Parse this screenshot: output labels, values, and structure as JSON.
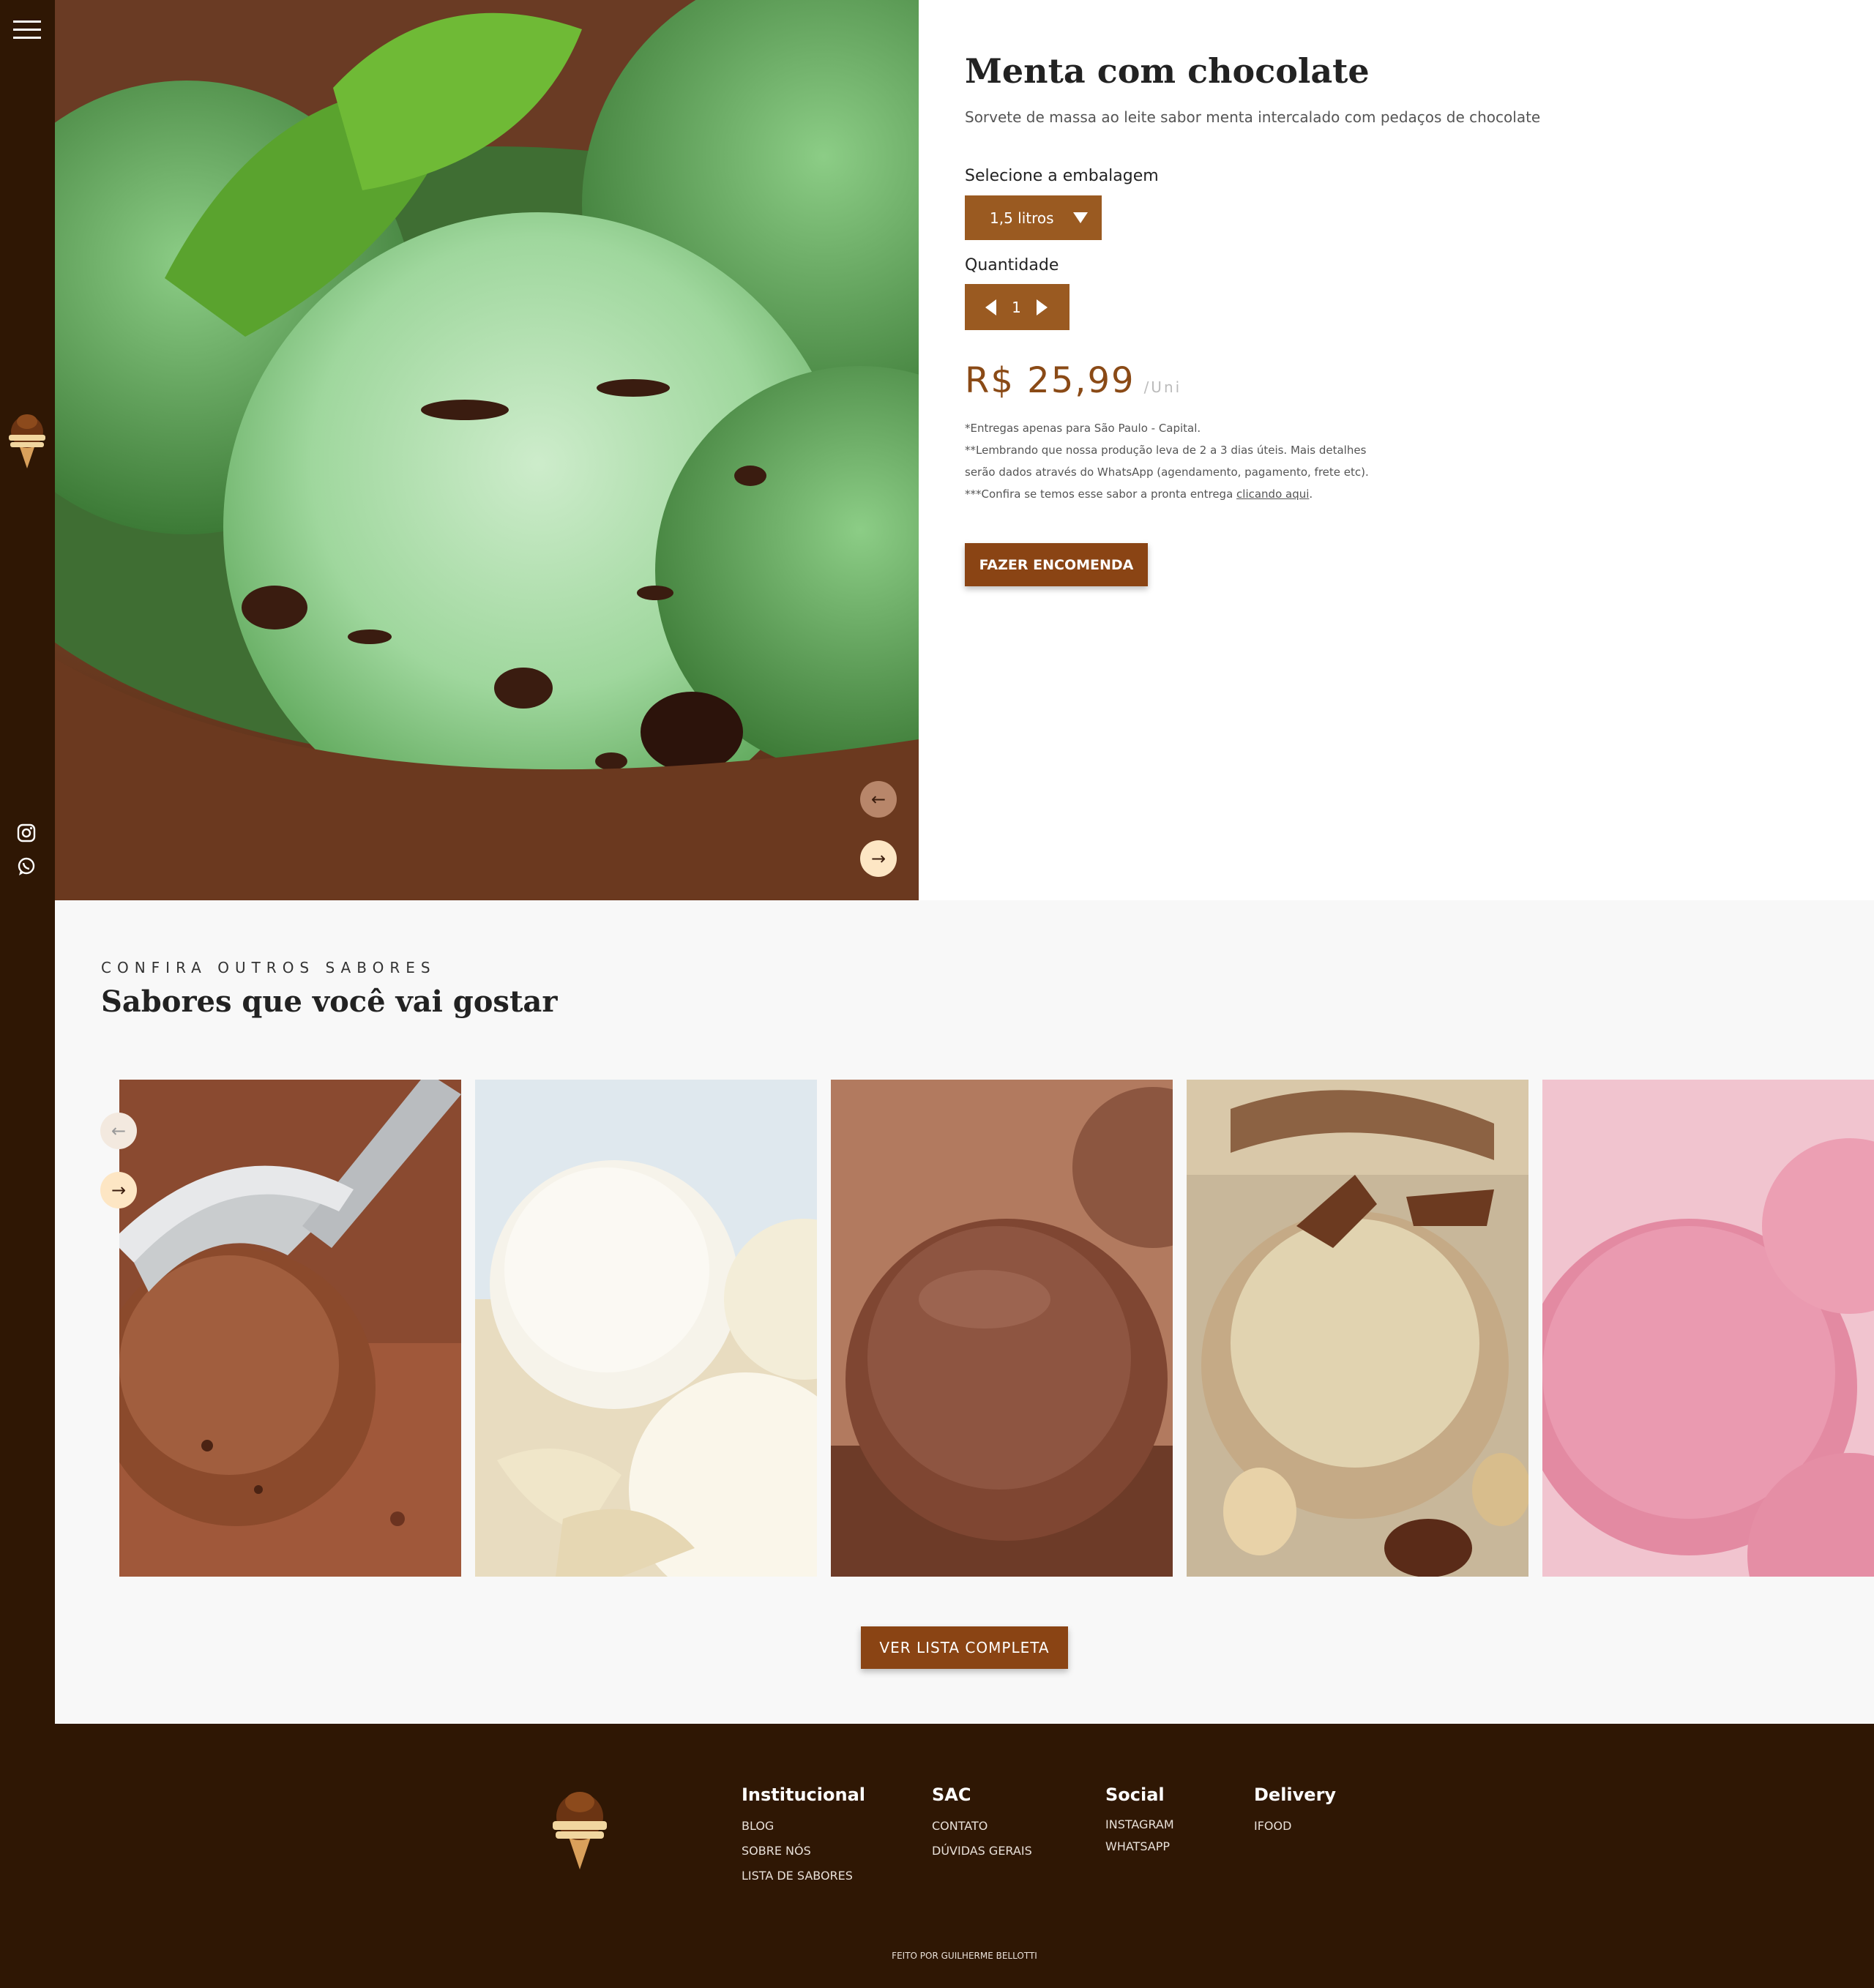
{
  "sidebar": {
    "menu_icon": "hamburger-icon",
    "logo_icon": "bellotti-logo",
    "social": [
      {
        "icon": "instagram-icon"
      },
      {
        "icon": "whatsapp-icon"
      }
    ]
  },
  "hero": {
    "image_alt": "mint chocolate chip ice cream",
    "prev_icon": "←",
    "next_icon": "→"
  },
  "product": {
    "title": "Menta com chocolate",
    "description": "Sorvete de massa ao leite sabor menta intercalado com pedaços de chocolate",
    "package_label": "Selecione a embalagem",
    "package_value": "1,5 litros",
    "quantity_label": "Quantidade",
    "quantity_value": "1",
    "price": "R$ 25,99",
    "unit": "/Uni",
    "notes": [
      "*Entregas apenas para São Paulo - Capital.",
      "**Lembrando que nossa produção leva de 2 a 3 dias úteis. Mais detalhes",
      "serão dados através do WhatsApp (agendamento, pagamento, frete etc).",
      "***Confira se temos esse sabor a pronta entrega "
    ],
    "notes_link": "clicando aqui",
    "notes_end": ".",
    "order_button": "FAZER ENCOMENDA"
  },
  "flavors": {
    "eyebrow": "CONFIRA OUTROS SABORES",
    "title": "Sabores que você vai gostar",
    "prev_icon": "←",
    "next_icon": "→",
    "list_button": "VER LISTA COMPLETA"
  },
  "footer": {
    "columns": [
      {
        "title": "Institucional",
        "links": [
          "BLOG",
          "SOBRE NÓS",
          "LISTA DE SABORES"
        ]
      },
      {
        "title": "SAC",
        "links": [
          "CONTATO",
          "DÚVIDAS GERAIS"
        ]
      },
      {
        "title": "Social",
        "links": [
          "INSTAGRAM",
          "WHATSAPP"
        ]
      },
      {
        "title": "Delivery",
        "links": [
          "IFOOD"
        ]
      }
    ],
    "credit": "FEITO POR GUILHERME BELLOTTI"
  },
  "colors": {
    "brown_dark": "#2f1704",
    "brown_button": "#8a4414",
    "brown_select": "#9a5a21",
    "price": "#8a4a16"
  }
}
